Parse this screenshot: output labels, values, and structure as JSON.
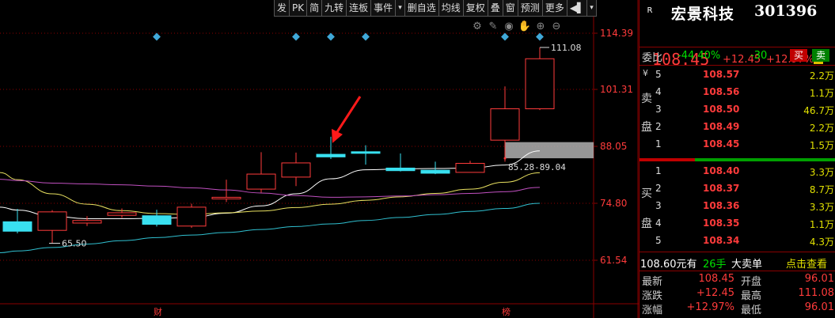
{
  "toolbar": [
    {
      "label": "发",
      "icon": null
    },
    {
      "label": "PK",
      "icon": null
    },
    {
      "label": "简",
      "icon": null
    },
    {
      "label": "九转",
      "icon": null
    },
    {
      "label": "连板",
      "icon": null
    },
    {
      "label": "事件",
      "icon": null
    },
    {
      "label": "▾",
      "icon": "dropdown-arrow-icon"
    },
    {
      "label": "删自选",
      "icon": null
    },
    {
      "label": "均线",
      "icon": null
    },
    {
      "label": "复权",
      "icon": null
    },
    {
      "label": "叠",
      "icon": null
    },
    {
      "label": "窗",
      "icon": null
    },
    {
      "label": "预测",
      "icon": null
    },
    {
      "label": "更多",
      "icon": null
    },
    {
      "label": "◀▌",
      "icon": "panel-collapse-icon"
    },
    {
      "label": "▾",
      "icon": "menu-dropdown-icon"
    }
  ],
  "chart_icons": [
    "settings-icon",
    "draw-pen-icon",
    "eye-icon",
    "hand-icon",
    "zoom-in-icon",
    "zoom-out-icon"
  ],
  "colors": {
    "up": "#ff3b3b",
    "down": "#39e0f0",
    "ma_white": "#ffffff",
    "ma_yellow": "#e8e060",
    "ma_purple": "#c050c0",
    "ma_cyan": "#30c0d0",
    "grid": "#8a0000"
  },
  "chart_data": {
    "type": "candlestick",
    "y_axis_labels": [
      "114.39",
      "101.31",
      "88.05",
      "74.80",
      "61.54"
    ],
    "y_axis_values": [
      114.39,
      101.31,
      88.05,
      74.8,
      61.54
    ],
    "candles": [
      {
        "o": 70.5,
        "c": 68.3,
        "h": 73.5,
        "l": 67.8
      },
      {
        "o": 68.5,
        "c": 72.8,
        "h": 73.2,
        "l": 65.5
      },
      {
        "o": 70.2,
        "c": 70.8,
        "h": 71.8,
        "l": 69.5
      },
      {
        "o": 72.0,
        "c": 72.6,
        "h": 73.6,
        "l": 71.4
      },
      {
        "o": 71.9,
        "c": 69.9,
        "h": 73.3,
        "l": 69.4
      },
      {
        "o": 69.5,
        "c": 73.9,
        "h": 74.7,
        "l": 69.1
      },
      {
        "o": 75.9,
        "c": 76.2,
        "h": 80.3,
        "l": 75.1
      },
      {
        "o": 78.1,
        "c": 81.6,
        "h": 86.7,
        "l": 77.3
      },
      {
        "o": 80.9,
        "c": 84.2,
        "h": 86.6,
        "l": 78.8
      },
      {
        "o": 86.2,
        "c": 85.6,
        "h": 90.3,
        "l": 85.1
      },
      {
        "o": 86.8,
        "c": 86.6,
        "h": 88.3,
        "l": 83.8
      },
      {
        "o": 83.0,
        "c": 82.4,
        "h": 86.4,
        "l": 82.2
      },
      {
        "o": 82.5,
        "c": 81.8,
        "h": 84.5,
        "l": 81.6
      },
      {
        "o": 82.0,
        "c": 84.1,
        "h": 84.7,
        "l": 82.0
      },
      {
        "o": 89.5,
        "c": 96.8,
        "h": 102.0,
        "l": 84.5
      },
      {
        "o": 96.8,
        "c": 108.45,
        "h": 111.08,
        "l": 96.5
      }
    ],
    "ma_lines": [
      {
        "color": "ma_white",
        "values": [
          73.2,
          71.8,
          71.2,
          71.2,
          71.3,
          71.5,
          72.5,
          74.2,
          77.0,
          80.5,
          82.6,
          82.8,
          82.9,
          83.0,
          83.7,
          87.0
        ]
      },
      {
        "color": "ma_yellow",
        "values": [
          80.3,
          77.0,
          74.6,
          73.1,
          72.4,
          72.2,
          72.6,
          73.0,
          73.8,
          74.6,
          75.5,
          76.3,
          77.1,
          78.1,
          79.7,
          81.9
        ]
      },
      {
        "color": "ma_purple",
        "values": [
          80.1,
          79.5,
          79.3,
          79.1,
          78.8,
          78.4,
          77.9,
          77.2,
          76.6,
          76.2,
          76.3,
          76.5,
          76.8,
          77.1,
          77.5,
          78.5
        ]
      },
      {
        "color": "ma_cyan",
        "values": [
          63.7,
          64.5,
          65.3,
          66.1,
          66.8,
          67.4,
          68.0,
          68.7,
          69.4,
          70.0,
          70.8,
          71.5,
          72.2,
          72.9,
          73.6,
          74.8
        ]
      }
    ],
    "labels": {
      "high": "111.08",
      "low": "65.50",
      "range": "85.28-89.04"
    },
    "range_band": [
      85.28,
      89.04
    ],
    "event_markers_x": [
      4,
      8,
      9,
      10,
      14,
      15
    ],
    "bottom_labels": [
      {
        "x": 5,
        "text": "财"
      },
      {
        "x": 15,
        "text": "榜"
      }
    ],
    "arrow_target": 9
  },
  "panel": {
    "r_label": "R",
    "name": "宏景科技",
    "code": "301396",
    "price": "108.45",
    "change": "+12.45",
    "change_pct": "+12.97%",
    "zhu": "注",
    "webi": {
      "label": "委比",
      "value": "-44.40%",
      "diff": "-30",
      "buy": "买",
      "sell": "卖"
    },
    "yen": "¥",
    "sell_chars": [
      "卖",
      "盘"
    ],
    "buy_chars": [
      "买",
      "盘"
    ],
    "asks": [
      {
        "level": "5",
        "price": "108.57",
        "vol": "2.2万"
      },
      {
        "level": "4",
        "price": "108.56",
        "vol": "1.1万"
      },
      {
        "level": "3",
        "price": "108.50",
        "vol": "46.7万"
      },
      {
        "level": "2",
        "price": "108.49",
        "vol": "2.2万"
      },
      {
        "level": "1",
        "price": "108.45",
        "vol": "1.5万"
      }
    ],
    "bids": [
      {
        "level": "1",
        "price": "108.40",
        "vol": "3.3万"
      },
      {
        "level": "2",
        "price": "108.37",
        "vol": "8.7万"
      },
      {
        "level": "3",
        "price": "108.36",
        "vol": "3.3万"
      },
      {
        "level": "4",
        "price": "108.35",
        "vol": "1.1万"
      },
      {
        "level": "5",
        "price": "108.34",
        "vol": "4.3万"
      }
    ],
    "trade": {
      "price": "108.60元有",
      "hand": "26手",
      "big": "大卖单",
      "click": "点击查看"
    },
    "stats": [
      {
        "l1": "最新",
        "v1": "108.45",
        "l2": "开盘",
        "v2": "96.01"
      },
      {
        "l1": "涨跌",
        "v1": "+12.45",
        "l2": "最高",
        "v2": "111.08"
      },
      {
        "l1": "涨幅",
        "v1": "+12.97%",
        "l2": "最低",
        "v2": "96.01"
      }
    ]
  }
}
